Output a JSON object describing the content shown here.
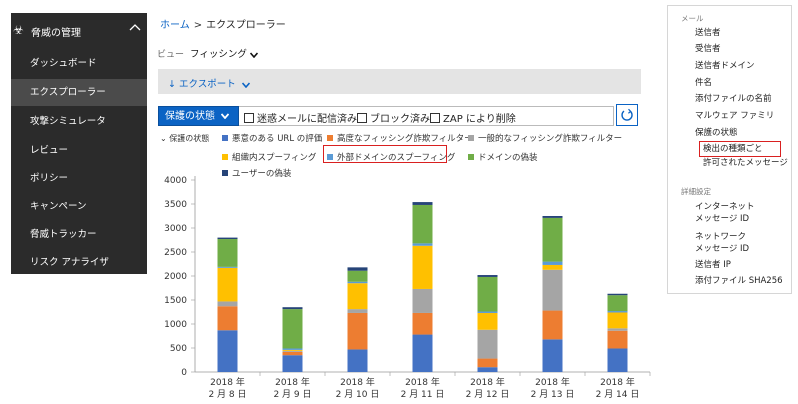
{
  "sidebar": {
    "header": "脅威の管理",
    "items": [
      {
        "label": "ダッシュボード",
        "active": false
      },
      {
        "label": "エクスプローラー",
        "active": true
      },
      {
        "label": "攻撃シミュレータ",
        "active": false
      },
      {
        "label": "レビュー",
        "active": false
      },
      {
        "label": "ポリシー",
        "active": false
      },
      {
        "label": "キャンペーン",
        "active": false
      },
      {
        "label": "脅威トラッカー",
        "active": false
      },
      {
        "label": "リスク アナライザ",
        "active": false
      }
    ]
  },
  "breadcrumb": {
    "home": "ホーム",
    "separator": ">",
    "current": "エクスプローラー"
  },
  "view": {
    "label": "ビュー",
    "value": "フィッシング"
  },
  "toolbar": {
    "export": "エクスポート"
  },
  "filter": {
    "state_button": "保護の状態",
    "checkboxes": [
      "迷惑メールに配信済み",
      "ブロック済み",
      "ZAP により削除"
    ]
  },
  "legend": {
    "title": "保護の状態",
    "items": [
      {
        "label": "悪意のある URL の評価",
        "color": "#4472c4"
      },
      {
        "label": "高度なフィッシング詐欺フィルター",
        "color": "#ed7d31"
      },
      {
        "label": "一般的なフィッシング詐欺フィルター",
        "color": "#a5a5a5"
      },
      {
        "label": "組織内スプーフィング",
        "color": "#ffc000"
      },
      {
        "label": "外部ドメインのスプーフィング",
        "color": "#5b9bd5"
      },
      {
        "label": "ドメインの偽装",
        "color": "#70ad47"
      },
      {
        "label": "ユーザーの偽装",
        "color": "#264478"
      }
    ]
  },
  "chart_data": {
    "type": "bar",
    "stacked": true,
    "categories": [
      [
        "2018 年",
        "2 月 8 日"
      ],
      [
        "2018 年",
        "2 月 9 日"
      ],
      [
        "2018 年",
        "2 月 10 日"
      ],
      [
        "2018 年",
        "2 月 11 日"
      ],
      [
        "2018 年",
        "2 月 12 日"
      ],
      [
        "2018 年",
        "2 月 13 日"
      ],
      [
        "2018 年",
        "2 月 14 日"
      ]
    ],
    "ylim": [
      0,
      4000
    ],
    "yticks": [
      0,
      500,
      1000,
      1500,
      2000,
      2500,
      3000,
      3500,
      4000
    ],
    "series": [
      {
        "name": "悪意のある URL の評価",
        "values": [
          870,
          350,
          470,
          780,
          100,
          680,
          490
        ]
      },
      {
        "name": "高度なフィッシング詐欺フィルター",
        "values": [
          500,
          70,
          760,
          450,
          180,
          600,
          370
        ]
      },
      {
        "name": "一般的なフィッシング詐欺フィルター",
        "values": [
          100,
          20,
          80,
          500,
          600,
          850,
          50
        ]
      },
      {
        "name": "組織内スプーフィング",
        "values": [
          700,
          20,
          540,
          900,
          350,
          100,
          330
        ]
      },
      {
        "name": "外部ドメインのスプーフィング",
        "values": [
          20,
          30,
          30,
          50,
          30,
          70,
          30
        ]
      },
      {
        "name": "ドメインの偽装",
        "values": [
          580,
          820,
          230,
          800,
          720,
          910,
          330
        ]
      },
      {
        "name": "ユーザーの偽装",
        "values": [
          30,
          40,
          70,
          60,
          40,
          40,
          30
        ]
      }
    ]
  },
  "right_panel": {
    "section_mail": "メール",
    "mail_items": [
      "送信者",
      "受信者",
      "送信者ドメイン",
      "件名",
      "添付ファイルの名前",
      "マルウェア ファミリ",
      "保護の状態"
    ],
    "selected_item": "検出の種類ごと",
    "allowed_item": "許可されたメッセージ",
    "section_details": "詳細設定",
    "detail_items": [
      "インターネット メッセージ ID",
      "ネットワーク メッセージ ID",
      "送信者 IP",
      "添付ファイル SHA256"
    ]
  }
}
